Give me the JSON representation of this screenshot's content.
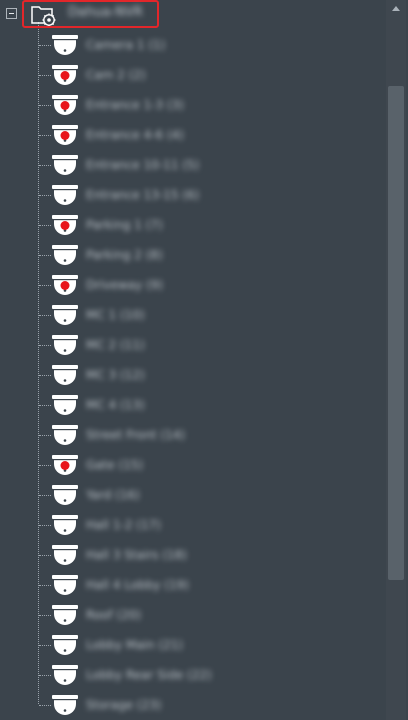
{
  "tree": {
    "root": {
      "label": "Dahua-NVR",
      "icon": "folder-gear-icon",
      "expanded": true,
      "selected": true
    },
    "accent_color": "#e2262a",
    "children": [
      {
        "label": "Camera 1 (1)",
        "status": "offline"
      },
      {
        "label": "Cam 2 (2)",
        "status": "recording"
      },
      {
        "label": "Entrance 1-3 (3)",
        "status": "recording"
      },
      {
        "label": "Entrance 4-6 (4)",
        "status": "recording"
      },
      {
        "label": "Entrance 10-11 (5)",
        "status": "offline"
      },
      {
        "label": "Entrance 13-15 (6)",
        "status": "offline"
      },
      {
        "label": "Parking 1 (7)",
        "status": "recording"
      },
      {
        "label": "Parking 2 (8)",
        "status": "offline"
      },
      {
        "label": "Driveway (9)",
        "status": "recording"
      },
      {
        "label": "MC 1 (10)",
        "status": "offline"
      },
      {
        "label": "MC 2 (11)",
        "status": "offline"
      },
      {
        "label": "MC 3 (12)",
        "status": "offline"
      },
      {
        "label": "MC 4 (13)",
        "status": "offline"
      },
      {
        "label": "Street Front (14)",
        "status": "offline"
      },
      {
        "label": "Gate (15)",
        "status": "recording"
      },
      {
        "label": "Yard (16)",
        "status": "offline"
      },
      {
        "label": "Hall 1-2 (17)",
        "status": "offline"
      },
      {
        "label": "Hall 3 Stairs (18)",
        "status": "offline"
      },
      {
        "label": "Hall 4 Lobby (19)",
        "status": "offline"
      },
      {
        "label": "Roof (20)",
        "status": "offline"
      },
      {
        "label": "Lobby Main (21)",
        "status": "offline"
      },
      {
        "label": "Lobby Rear Side (22)",
        "status": "offline"
      },
      {
        "label": "Storage (23)",
        "status": "offline"
      }
    ]
  }
}
